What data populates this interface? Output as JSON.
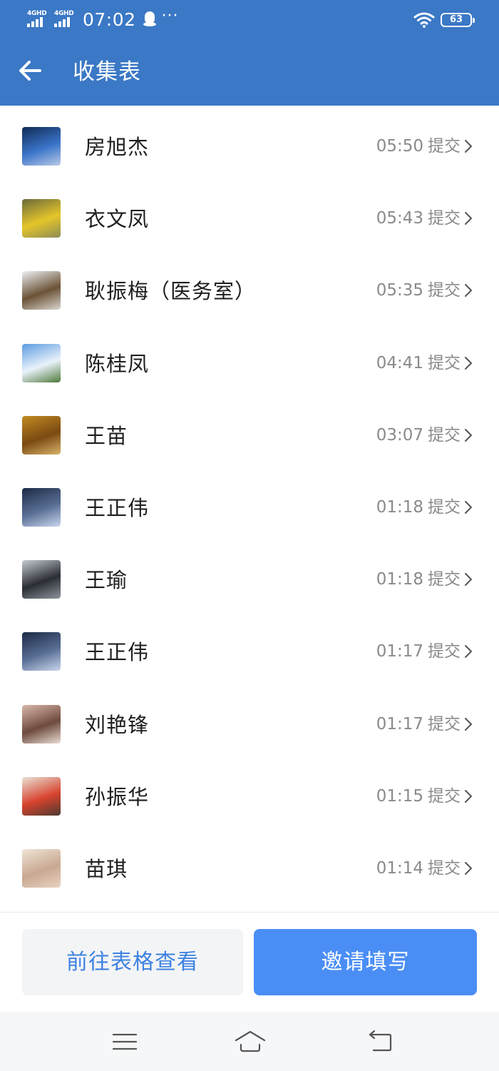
{
  "status_bar": {
    "net1": "4GHD",
    "net2": "4GHD",
    "time": "07:02",
    "more": "···",
    "battery": "63"
  },
  "nav": {
    "title": "收集表",
    "back_icon": "arrow-left-icon"
  },
  "submissions": [
    {
      "name": "房旭杰",
      "time": "05:50",
      "status": "提交",
      "avatar_colors": [
        "#0f2a55",
        "#3a74c9",
        "#b8c9e6"
      ]
    },
    {
      "name": "衣文凤",
      "time": "05:43",
      "status": "提交",
      "avatar_colors": [
        "#6b6a3c",
        "#e5c52a",
        "#8d8c55"
      ]
    },
    {
      "name": "耿振梅（医务室）",
      "time": "05:35",
      "status": "提交",
      "avatar_colors": [
        "#eef0f2",
        "#6b5236",
        "#d9d6cf"
      ]
    },
    {
      "name": "陈桂凤",
      "time": "04:41",
      "status": "提交",
      "avatar_colors": [
        "#5b9be0",
        "#eaf2fb",
        "#4d7a3a"
      ]
    },
    {
      "name": "王苗",
      "time": "03:07",
      "status": "提交",
      "avatar_colors": [
        "#c28a22",
        "#7a4a12",
        "#d8b36a"
      ]
    },
    {
      "name": "王正伟",
      "time": "01:18",
      "status": "提交",
      "avatar_colors": [
        "#1b2a44",
        "#5a6f95",
        "#c9d6ec"
      ]
    },
    {
      "name": "王瑜",
      "time": "01:18",
      "status": "提交",
      "avatar_colors": [
        "#c7ccd3",
        "#2a2d33",
        "#8d949e"
      ]
    },
    {
      "name": "王正伟",
      "time": "01:17",
      "status": "提交",
      "avatar_colors": [
        "#1b2a44",
        "#5a6f95",
        "#c9d6ec"
      ]
    },
    {
      "name": "刘艳锋",
      "time": "01:17",
      "status": "提交",
      "avatar_colors": [
        "#d9b8a9",
        "#6e4a3d",
        "#e9dcd4"
      ]
    },
    {
      "name": "孙振华",
      "time": "01:15",
      "status": "提交",
      "avatar_colors": [
        "#e9e2d6",
        "#d8432f",
        "#4a3a2e"
      ]
    },
    {
      "name": "苗琪",
      "time": "01:14",
      "status": "提交",
      "avatar_colors": [
        "#efe4d6",
        "#c9a892",
        "#e8d2c0"
      ]
    }
  ],
  "actions": {
    "view_table": "前往表格查看",
    "invite_fill": "邀请填写"
  },
  "colors": {
    "header_bg": "#3b78c5",
    "primary": "#4a8ef5",
    "secondary_text": "#3e82e2",
    "meta_text": "#8a8a8a"
  }
}
